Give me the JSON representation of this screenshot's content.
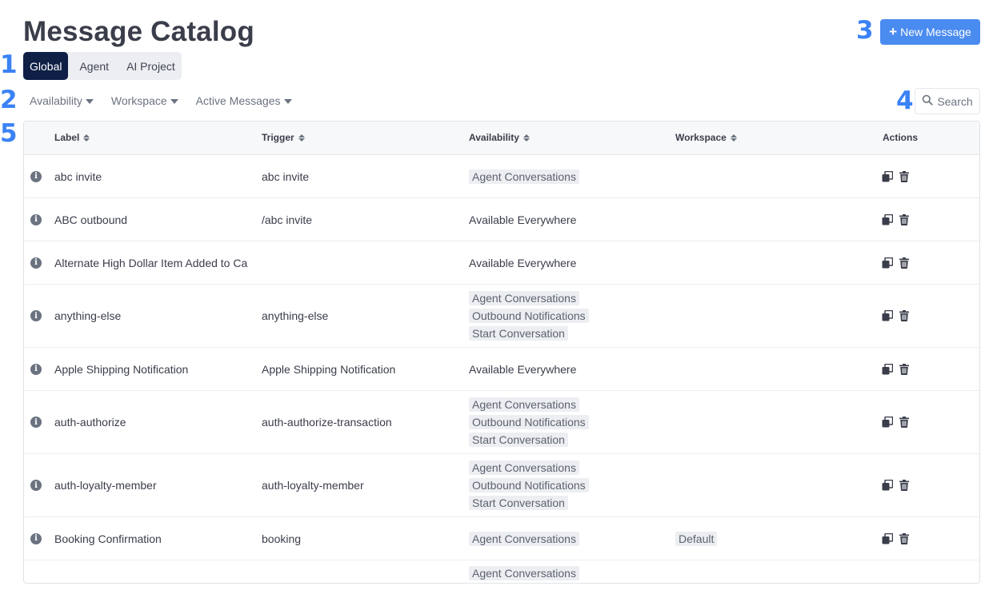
{
  "page": {
    "title": "Message Catalog"
  },
  "callouts": [
    "1",
    "2",
    "3",
    "4",
    "5"
  ],
  "new_message_button": {
    "icon": "plus-icon",
    "label": "New Message"
  },
  "scope_tabs": [
    {
      "label": "Global",
      "active": true
    },
    {
      "label": "Agent",
      "active": false
    },
    {
      "label": "AI Project",
      "active": false
    }
  ],
  "filters": [
    {
      "label": "Availability"
    },
    {
      "label": "Workspace"
    },
    {
      "label": "Active Messages"
    }
  ],
  "search": {
    "label": "Search",
    "icon": "search-icon"
  },
  "table": {
    "columns": [
      "Label",
      "Trigger",
      "Availability",
      "Workspace",
      "Actions"
    ],
    "rows": [
      {
        "label": "abc invite",
        "trigger": "abc invite",
        "availability": [
          "Agent Conversations"
        ],
        "availability_text": "",
        "workspace": ""
      },
      {
        "label": "ABC outbound",
        "trigger": "/abc invite",
        "availability": [],
        "availability_text": "Available Everywhere",
        "workspace": ""
      },
      {
        "label": "Alternate High Dollar Item Added to Ca",
        "trigger": "",
        "availability": [],
        "availability_text": "Available Everywhere",
        "workspace": ""
      },
      {
        "label": "anything-else",
        "trigger": "anything-else",
        "availability": [
          "Agent Conversations",
          "Outbound Notifications",
          "Start Conversation"
        ],
        "availability_text": "",
        "workspace": ""
      },
      {
        "label": "Apple Shipping Notification",
        "trigger": "Apple Shipping Notification",
        "availability": [],
        "availability_text": "Available Everywhere",
        "workspace": ""
      },
      {
        "label": "auth-authorize",
        "trigger": "auth-authorize-transaction",
        "availability": [
          "Agent Conversations",
          "Outbound Notifications",
          "Start Conversation"
        ],
        "availability_text": "",
        "workspace": ""
      },
      {
        "label": "auth-loyalty-member",
        "trigger": "auth-loyalty-member",
        "availability": [
          "Agent Conversations",
          "Outbound Notifications",
          "Start Conversation"
        ],
        "availability_text": "",
        "workspace": ""
      },
      {
        "label": "Booking Confirmation",
        "trigger": "booking",
        "availability": [
          "Agent Conversations"
        ],
        "availability_text": "",
        "workspace": "Default"
      },
      {
        "label": "",
        "trigger": "",
        "availability": [
          "Agent Conversations"
        ],
        "availability_text": "",
        "workspace": ""
      }
    ]
  },
  "icons": {
    "info": "info-icon",
    "duplicate": "duplicate-icon",
    "delete": "trash-icon"
  },
  "colors": {
    "accent": "#4a8bf0",
    "callout": "#3b82f6",
    "active_tab": "#0f1f45"
  }
}
